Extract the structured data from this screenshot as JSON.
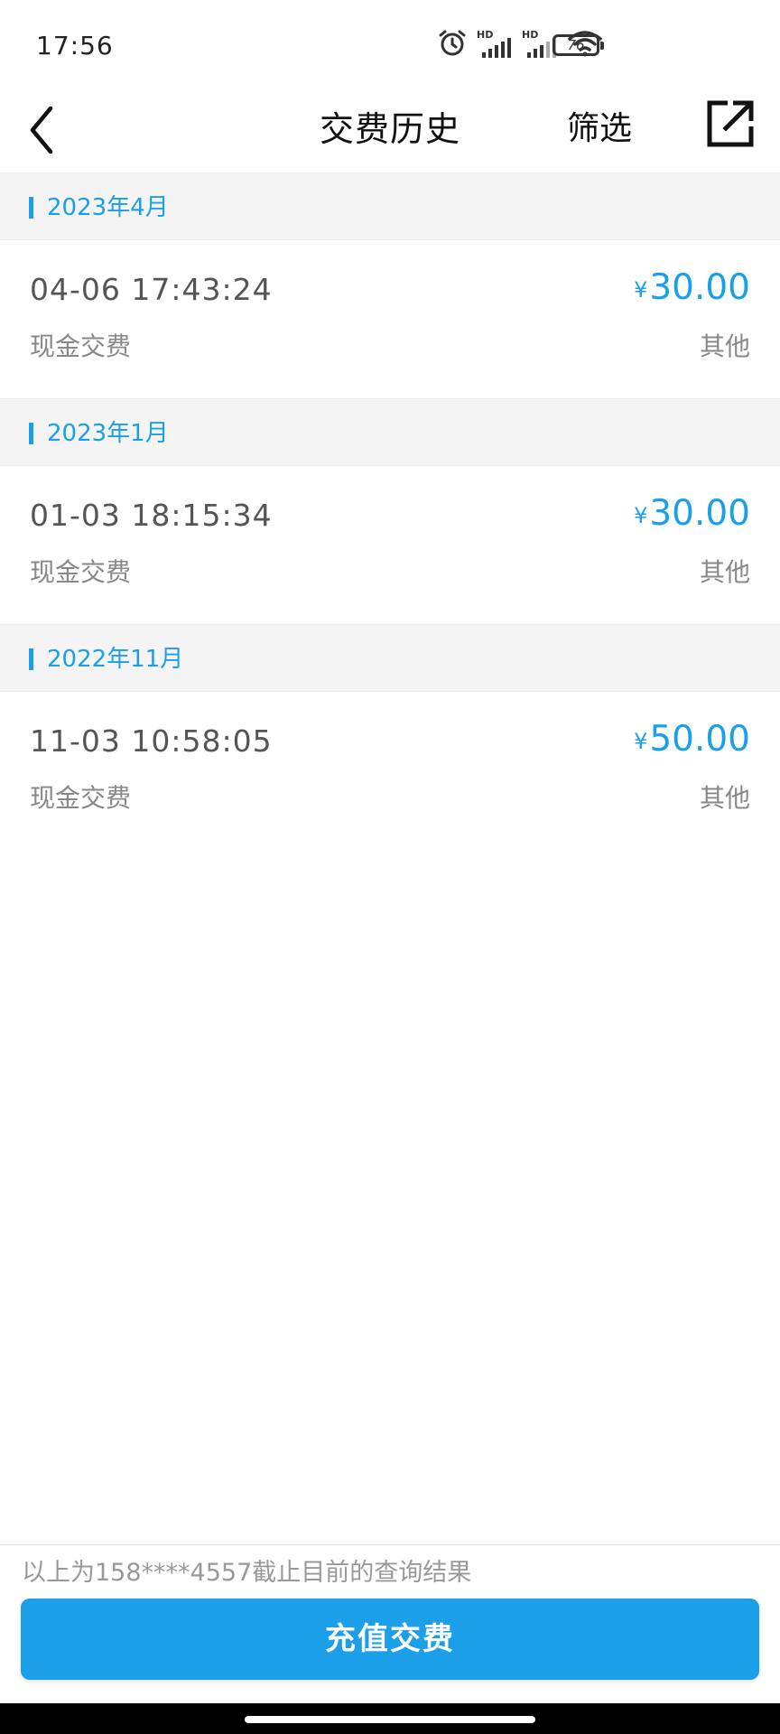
{
  "status_bar": {
    "time": "17:56",
    "hd1": "HD",
    "hd2": "HD",
    "battery": "76",
    "icons": [
      "alarm-icon",
      "signal-icon",
      "signal-icon",
      "wifi-icon",
      "battery-icon"
    ]
  },
  "header": {
    "title": "交费历史",
    "filter_label": "筛选",
    "back_icon": "chevron-left-icon",
    "share_icon": "share-export-icon"
  },
  "groups": [
    {
      "month": "2023年4月",
      "records": [
        {
          "time": "04-06 17:43:24",
          "currency": "¥",
          "amount": "30.00",
          "method": "现金交费",
          "category": "其他"
        }
      ]
    },
    {
      "month": "2023年1月",
      "records": [
        {
          "time": "01-03 18:15:34",
          "currency": "¥",
          "amount": "30.00",
          "method": "现金交费",
          "category": "其他"
        }
      ]
    },
    {
      "month": "2022年11月",
      "records": [
        {
          "time": "11-03 10:58:05",
          "currency": "¥",
          "amount": "50.00",
          "method": "现金交费",
          "category": "其他"
        }
      ]
    }
  ],
  "footer": {
    "note": "以上为158****4557截止目前的查询结果",
    "button_label": "充值交费"
  },
  "colors": {
    "accent": "#1a9fe8",
    "section_bg": "#f4f4f4",
    "secondary_text": "#888888"
  }
}
